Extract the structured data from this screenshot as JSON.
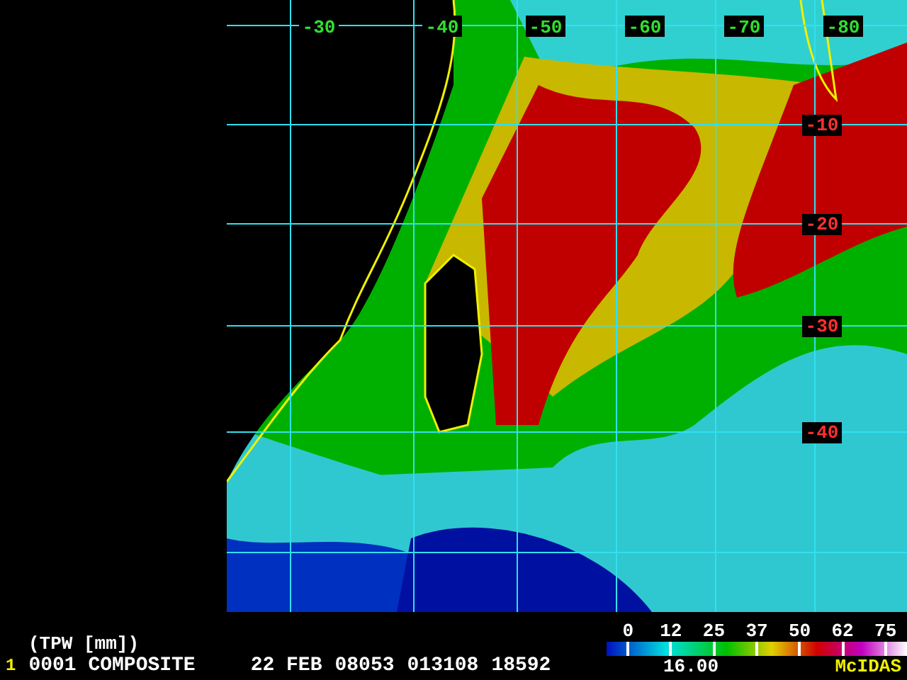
{
  "map": {
    "longitude_labels": [
      "-30",
      "-40",
      "-50",
      "-60",
      "-70",
      "-80"
    ],
    "latitude_labels": [
      "-10",
      "-20",
      "-30",
      "-40"
    ]
  },
  "legend": {
    "title": "(TPW [mm])",
    "ticks": [
      "0",
      "12",
      "25",
      "37",
      "50",
      "62",
      "75"
    ],
    "reading": "16.00",
    "brand": "McIDAS"
  },
  "status": {
    "frame": "1",
    "product": "0001 COMPOSITE",
    "date": "22 FEB",
    "fields": [
      "08053",
      "013108",
      "18592"
    ]
  }
}
